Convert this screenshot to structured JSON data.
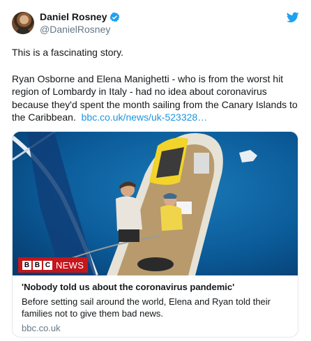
{
  "author": {
    "display_name": "Daniel Rosney",
    "handle": "@DanielRosney",
    "verified": true,
    "avatar_icon": "user-avatar"
  },
  "brand": {
    "icon": "twitter-bird-icon",
    "color": "#1da1f2"
  },
  "tweet": {
    "paragraph1": "This is a fascinating story.",
    "paragraph2": "Ryan Osborne and Elena Manighetti - who is from the worst hit region of Lombardy in Italy - had no idea about coronavirus because they'd spent the month sailing from the Canary Islands to the Caribbean.",
    "link_text": "bbc.co.uk/news/uk-523328…",
    "link_color": "#1b95e0"
  },
  "card": {
    "badge_letters": [
      "B",
      "B",
      "C"
    ],
    "badge_word": "NEWS",
    "badge_color": "#c4161c",
    "title": "'Nobody told us about the coronavirus pandemic'",
    "description": "Before setting sail around the world, Elena and Ryan told their families not to give them bad news.",
    "domain": "bbc.co.uk"
  }
}
